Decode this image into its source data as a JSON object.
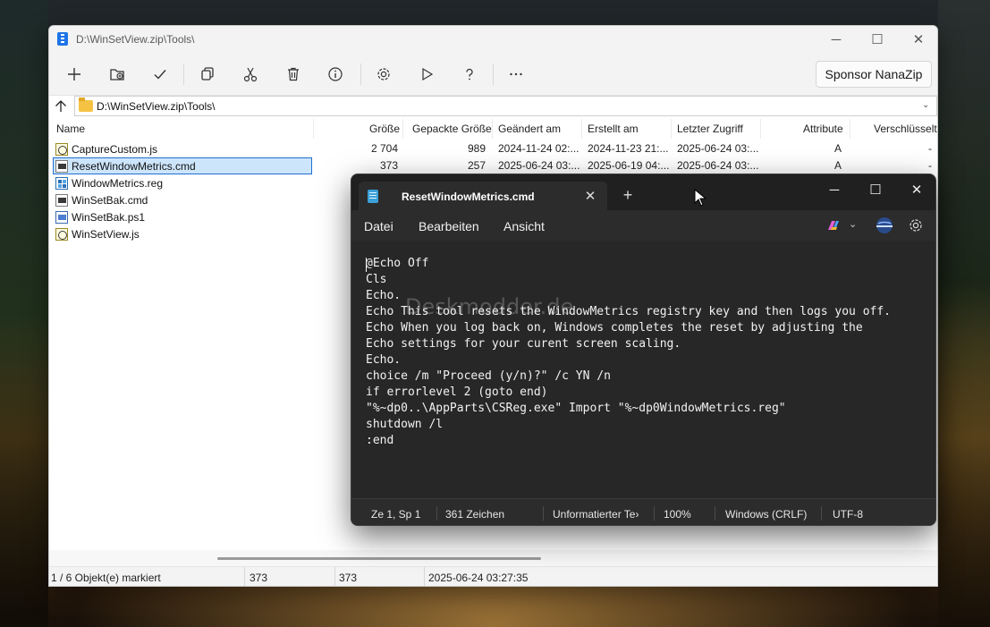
{
  "nanazip": {
    "title": "D:\\WinSetView.zip\\Tools\\",
    "sponsor_label": "Sponsor NanaZip",
    "address": "D:\\WinSetView.zip\\Tools\\",
    "columns": [
      "Name",
      "Größe",
      "Gepackte Größe",
      "Geändert am",
      "Erstellt am",
      "Letzter Zugriff",
      "Attribute",
      "Verschlüsselt"
    ],
    "files": [
      {
        "name": "CaptureCustom.js",
        "size": "2 704",
        "packed": "989",
        "modified": "2024-11-24 02:...",
        "created": "2024-11-23 21:...",
        "accessed": "2025-06-24 03:...",
        "attr": "A",
        "enc": "-"
      },
      {
        "name": "ResetWindowMetrics.cmd",
        "size": "373",
        "packed": "257",
        "modified": "2025-06-24 03:...",
        "created": "2025-06-19 04:...",
        "accessed": "2025-06-24 03:...",
        "attr": "A",
        "enc": "-"
      },
      {
        "name": "WindowMetrics.reg"
      },
      {
        "name": "WinSetBak.cmd"
      },
      {
        "name": "WinSetBak.ps1"
      },
      {
        "name": "WinSetView.js"
      }
    ],
    "status": {
      "selection": "1 / 6 Objekt(e) markiert",
      "size": "373",
      "packed": "373",
      "date": "2025-06-24 03:27:35"
    }
  },
  "notepad": {
    "tab_title": "ResetWindowMetrics.cmd",
    "menu": [
      "Datei",
      "Bearbeiten",
      "Ansicht"
    ],
    "watermark": "Deskmodder.de",
    "lines": [
      "@Echo Off",
      "Cls",
      "Echo.",
      "Echo This tool resets the WindowMetrics registry key and then logs you off.",
      "Echo When you log back on, Windows completes the reset by adjusting the",
      "Echo settings for your curent screen scaling.",
      "Echo.",
      "choice /m \"Proceed (y/n)?\" /c YN /n",
      "if errorlevel 2 (goto end)",
      "\"%~dp0..\\AppParts\\CSReg.exe\" Import \"%~dp0WindowMetrics.reg\"",
      "shutdown /l",
      ":end"
    ],
    "status": {
      "position": "Ze 1, Sp 1",
      "chars": "361 Zeichen",
      "format": "Unformatierter Te›",
      "zoom": "100%",
      "eol": "Windows (CRLF)",
      "encoding": "UTF-8"
    }
  },
  "icons": {
    "toolbar": [
      "add-icon",
      "extract-icon",
      "test-icon",
      "copy-icon",
      "move-icon",
      "delete-icon",
      "info-icon",
      "settings-icon",
      "benchmark-icon",
      "help-icon",
      "more-icon"
    ]
  }
}
